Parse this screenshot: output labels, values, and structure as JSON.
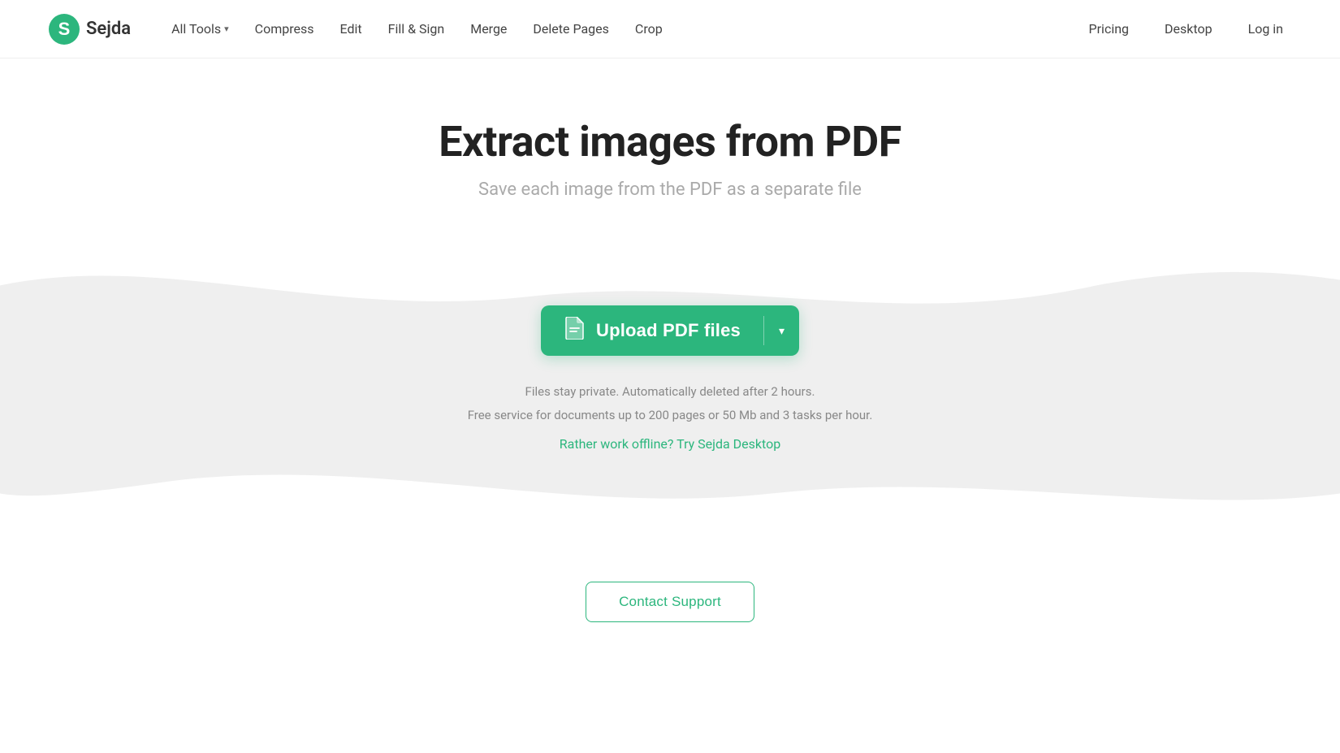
{
  "brand": {
    "logo_text": "Sejda",
    "logo_color": "#2cb67d"
  },
  "nav": {
    "all_tools_label": "All Tools",
    "items": [
      {
        "label": "Compress",
        "id": "compress"
      },
      {
        "label": "Edit",
        "id": "edit"
      },
      {
        "label": "Fill & Sign",
        "id": "fill-sign"
      },
      {
        "label": "Merge",
        "id": "merge"
      },
      {
        "label": "Delete Pages",
        "id": "delete-pages"
      },
      {
        "label": "Crop",
        "id": "crop"
      }
    ]
  },
  "header_right": {
    "pricing": "Pricing",
    "desktop": "Desktop",
    "login": "Log in"
  },
  "hero": {
    "title": "Extract images from PDF",
    "subtitle": "Save each image from the PDF as a separate file"
  },
  "upload": {
    "button_label": "Upload PDF files",
    "icon": "📄"
  },
  "privacy": {
    "line1": "Files stay private. Automatically deleted after 2 hours.",
    "line2": "Free service for documents up to 200 pages or 50 Mb and 3 tasks per hour."
  },
  "offline_link": {
    "label": "Rather work offline? Try Sejda Desktop"
  },
  "footer": {
    "contact_support": "Contact Support"
  },
  "colors": {
    "brand_green": "#2cb67d",
    "text_dark": "#222",
    "text_gray": "#aaa",
    "text_medium": "#888"
  }
}
